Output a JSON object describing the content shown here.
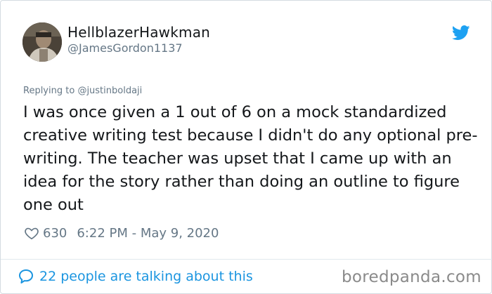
{
  "tweet": {
    "display_name": "HellblazerHawkman",
    "handle": "@JamesGordon1137",
    "replying_prefix": "Replying to",
    "replying_to": "@justinboldaji",
    "text": "I was once given a 1 out of 6 on a mock standardized creative writing test because I didn't do any optional pre-writing. The teacher was upset that I came up with an idea for the story rather than doing an outline to figure one out",
    "like_count": "630",
    "timestamp": "6:22 PM - May 9, 2020",
    "talking": "22 people are talking about this"
  },
  "watermark": "boredpanda.com",
  "icons": {
    "brand": "twitter-bird-icon",
    "like": "heart-icon",
    "conversation": "speech-bubble-icon"
  },
  "colors": {
    "twitter_blue": "#1da1f2",
    "link_blue": "#1b95e0",
    "text": "#14171a",
    "muted": "#657786",
    "border": "#d4dbe1"
  }
}
